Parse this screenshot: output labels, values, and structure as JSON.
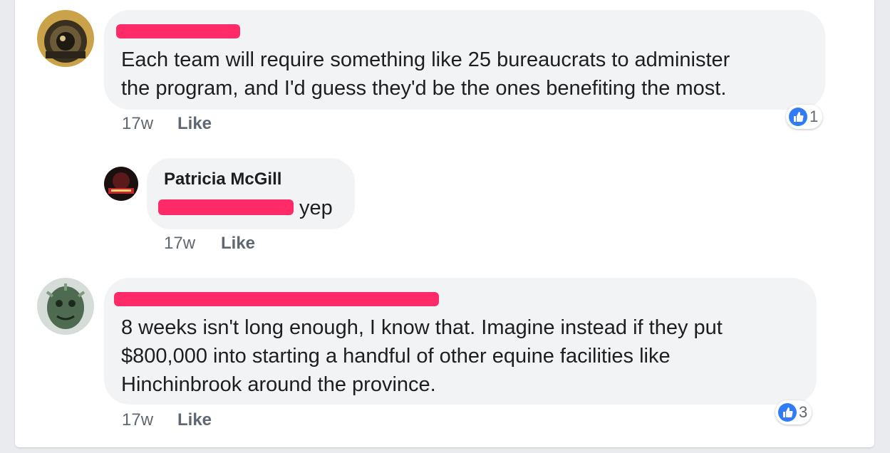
{
  "comments": [
    {
      "text_line1": "Each team will require something like 25 bureaucrats to administer",
      "text_line2": "the program, and I'd guess they'd be the ones benefiting the most.",
      "time": "17w",
      "like_label": "Like",
      "reaction_count": "1",
      "reaction_icon": "thumbs-up-icon"
    },
    {
      "name": "Patricia McGill",
      "text_suffix": "yep",
      "time": "17w",
      "like_label": "Like"
    },
    {
      "text_line1": "8 weeks isn't long enough, I know that. Imagine instead if they put",
      "text_line2": "$800,000 into starting a handful of other equine facilities like",
      "text_line3": "Hinchinbrook around the province.",
      "time": "17w",
      "like_label": "Like",
      "reaction_count": "3",
      "reaction_icon": "thumbs-up-icon"
    }
  ],
  "colors": {
    "bubble": "#f2f3f5",
    "redaction": "#ff2a68",
    "like_blue": "#2f7cf6"
  }
}
